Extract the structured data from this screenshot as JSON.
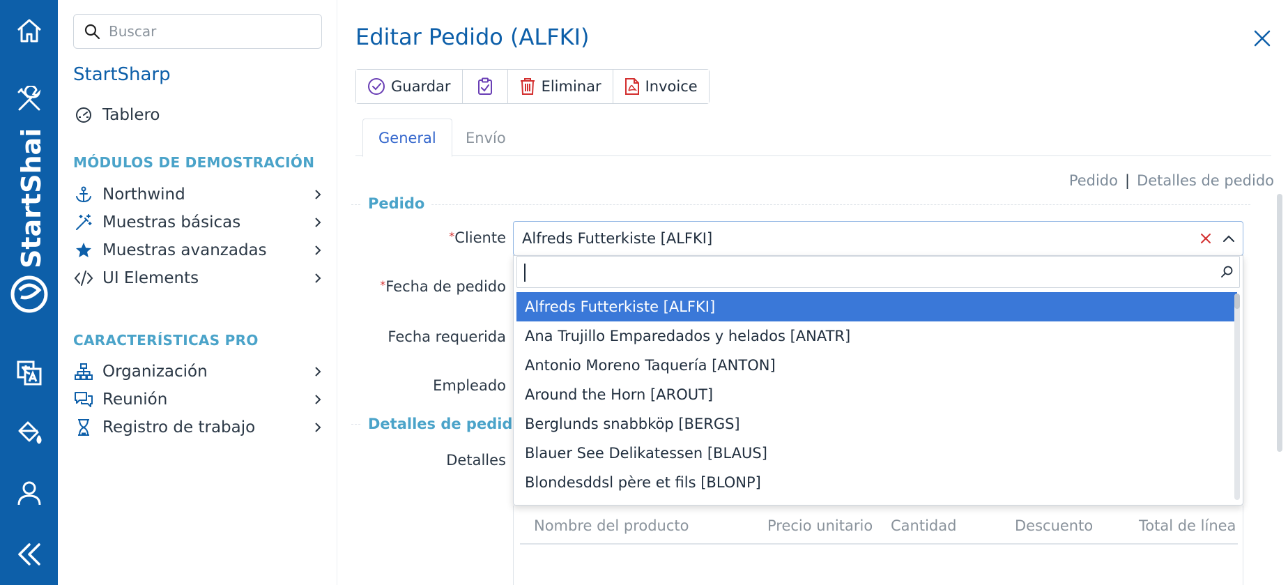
{
  "rail": {
    "brand": "StartShai",
    "icons": [
      "home-icon",
      "tools-icon",
      "translate-icon",
      "paint-bucket-icon",
      "user-icon",
      "collapse-icon"
    ]
  },
  "sidebar": {
    "search_placeholder": "Buscar",
    "brand_title": "StartSharp",
    "dashboard": "Tablero",
    "section_demo": "MÓDULOS DE DEMOSTRACIÓN",
    "demo_items": [
      "Northwind",
      "Muestras básicas",
      "Muestras avanzadas",
      "UI Elements"
    ],
    "section_pro": "CARACTERÍSTICAS PRO",
    "pro_items": [
      "Organización",
      "Reunión",
      "Registro de trabajo"
    ]
  },
  "dialog": {
    "title": "Editar Pedido (ALFKI)",
    "toolbar": {
      "save": "Guardar",
      "delete": "Eliminar",
      "invoice": "Invoice"
    },
    "tabs": [
      "General",
      "Envío"
    ],
    "links": [
      "Pedido",
      "|",
      "Detalles de pedido"
    ],
    "category_order": "Pedido",
    "category_details": "Detalles de pedido",
    "labels": {
      "customer": "Cliente",
      "order_date": "Fecha de pedido",
      "required_date": "Fecha requerida",
      "employee": "Empleado",
      "details": "Detalles"
    },
    "customer_value": "Alfreds Futterkiste [ALFKI]",
    "dropdown_items": [
      "Alfreds Futterkiste [ALFKI]",
      "Ana Trujillo Emparedados y helados [ANATR]",
      "Antonio Moreno Taquería [ANTON]",
      "Around the Horn [AROUT]",
      "Berglunds snabbköp [BERGS]",
      "Blauer See Delikatessen [BLAUS]",
      "Blondesddsl père et fils [BLONP]"
    ],
    "grid_columns": [
      "Nombre del producto",
      "Precio unitario",
      "Cantidad",
      "Descuento",
      "Total de línea"
    ]
  },
  "colors": {
    "rail": "#0d5fa9",
    "accent": "#0d5fa9",
    "section": "#4aa3c9",
    "selected": "#3a78d8"
  }
}
